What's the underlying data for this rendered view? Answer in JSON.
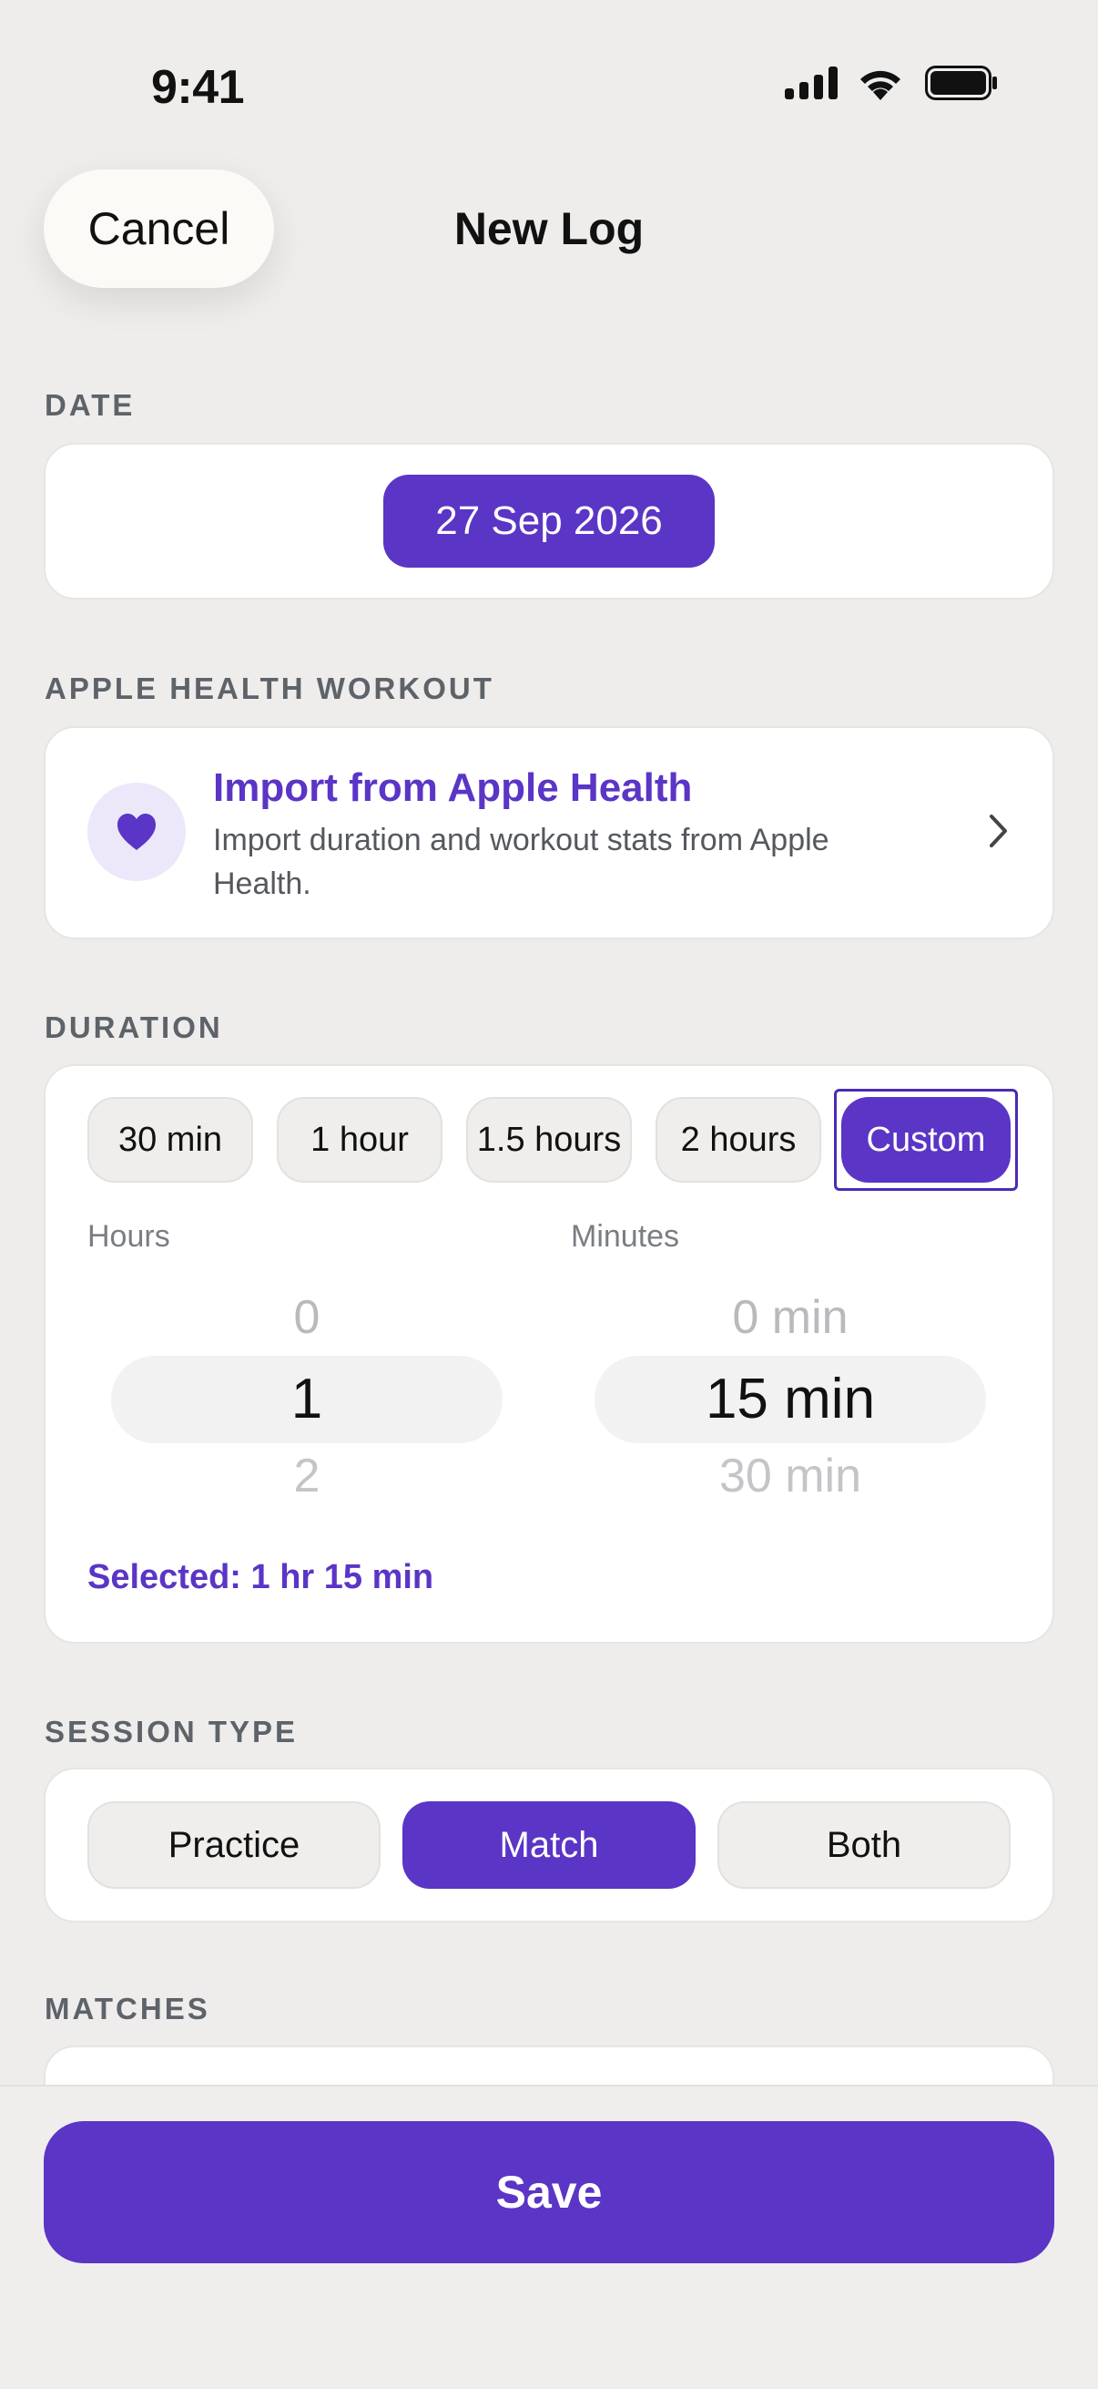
{
  "status_bar": {
    "time": "9:41",
    "icons": [
      "cellular-signal-icon",
      "wifi-icon",
      "battery-icon"
    ]
  },
  "nav": {
    "cancel_label": "Cancel",
    "title": "New Log"
  },
  "date_section": {
    "label": "DATE",
    "value": "27 Sep 2026"
  },
  "health_section": {
    "label": "APPLE HEALTH WORKOUT",
    "title": "Import from Apple Health",
    "description": "Import duration and workout stats from Apple Health.",
    "icon": "heart-icon"
  },
  "duration_section": {
    "label": "DURATION",
    "presets": [
      "30 min",
      "1 hour",
      "1.5 hours",
      "2 hours",
      "Custom"
    ],
    "selected_preset": "Custom",
    "hours_label": "Hours",
    "minutes_label": "Minutes",
    "hours": {
      "prev": "0",
      "current": "1",
      "next": "2"
    },
    "minutes": {
      "prev": "0 min",
      "current": "15 min",
      "next": "30 min"
    },
    "selected_summary": "Selected: 1 hr 15 min"
  },
  "session_section": {
    "label": "SESSION TYPE",
    "options": [
      "Practice",
      "Match",
      "Both"
    ],
    "selected": "Match"
  },
  "matches_section": {
    "label": "MATCHES"
  },
  "save_label": "Save",
  "colors": {
    "accent": "#5a35c6",
    "background": "#eeedec",
    "card": "#ffffff"
  }
}
